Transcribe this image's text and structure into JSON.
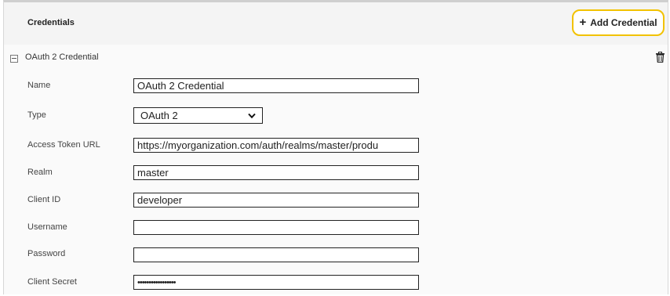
{
  "header": {
    "title": "Credentials",
    "add_button_label": "Add Credential",
    "add_icon": "plus-icon"
  },
  "credential": {
    "section_title": "OAuth 2 Credential",
    "collapse_icon": "collapse-minus-icon",
    "delete_icon": "trash-icon",
    "fields": {
      "name": {
        "label": "Name",
        "value": "OAuth 2 Credential"
      },
      "type": {
        "label": "Type",
        "value": "OAuth 2"
      },
      "access_token_url": {
        "label": "Access Token URL",
        "value": "https://myorganization.com/auth/realms/master/produ"
      },
      "realm": {
        "label": "Realm",
        "value": "master"
      },
      "client_id": {
        "label": "Client ID",
        "value": "developer"
      },
      "username": {
        "label": "Username",
        "value": ""
      },
      "password": {
        "label": "Password",
        "value": ""
      },
      "client_secret": {
        "label": "Client Secret",
        "value": "•••••••••••••••••"
      }
    }
  }
}
